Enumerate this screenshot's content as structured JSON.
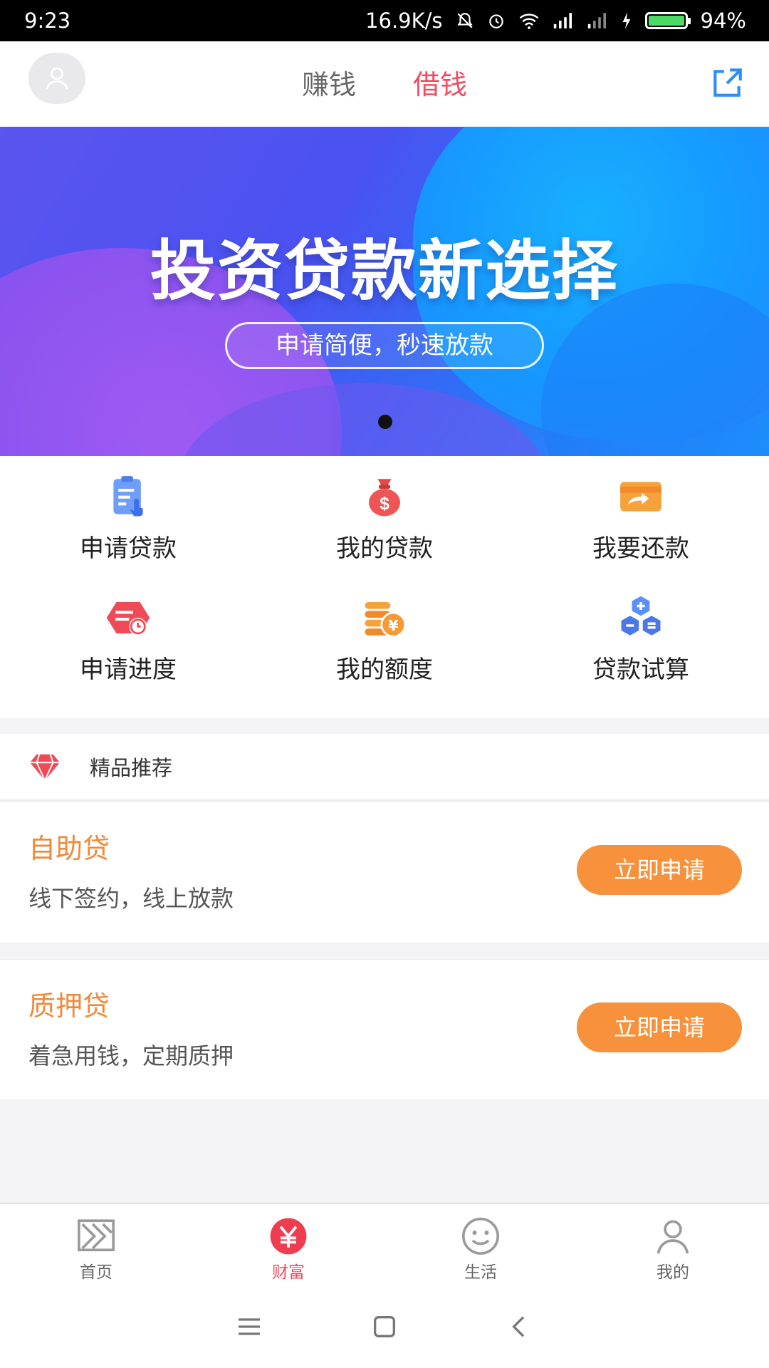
{
  "status_bar": {
    "time": "9:23",
    "net_speed": "16.9K/s",
    "battery": "94%",
    "battery_level": 0.94
  },
  "header": {
    "tabs": [
      {
        "label": "赚钱",
        "active": false
      },
      {
        "label": "借钱",
        "active": true
      }
    ],
    "active_color": "#f24b5f"
  },
  "banner": {
    "title": "投资贷款新选择",
    "subtitle": "申请简便，秒速放款"
  },
  "grid": [
    {
      "label": "申请贷款",
      "icon": "clipboard-icon"
    },
    {
      "label": "我的贷款",
      "icon": "money-bag-icon"
    },
    {
      "label": "我要还款",
      "icon": "card-icon"
    },
    {
      "label": "申请进度",
      "icon": "progress-clock-icon"
    },
    {
      "label": "我的额度",
      "icon": "coins-icon"
    },
    {
      "label": "贷款试算",
      "icon": "calculator-icon"
    }
  ],
  "section": {
    "title": "精品推荐",
    "icon": "diamond-icon"
  },
  "products": [
    {
      "title": "自助贷",
      "desc": "线下签约，线上放款",
      "button": "立即申请"
    },
    {
      "title": "质押贷",
      "desc": "着急用钱，定期质押",
      "button": "立即申请"
    }
  ],
  "bottom_nav": [
    {
      "label": "首页",
      "icon": "home-icon",
      "active": false
    },
    {
      "label": "财富",
      "icon": "yen-icon",
      "active": true
    },
    {
      "label": "生活",
      "icon": "smile-icon",
      "active": false
    },
    {
      "label": "我的",
      "icon": "user-icon",
      "active": false
    }
  ],
  "colors": {
    "accent_orange": "#f7913b",
    "accent_red": "#f24b5f",
    "grid_blue": "#5b8ff9"
  }
}
